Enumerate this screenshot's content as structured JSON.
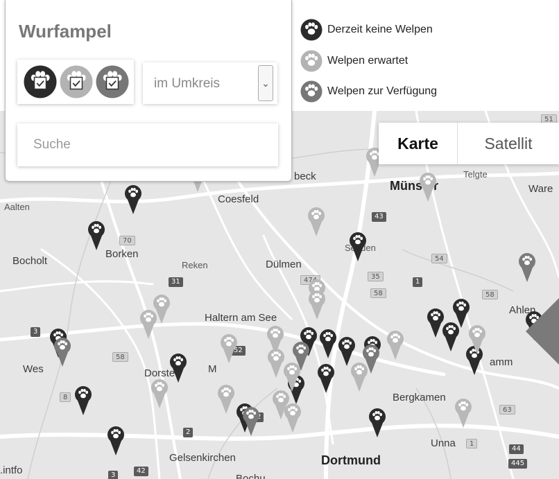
{
  "panel": {
    "title": "Wurfampel",
    "filters": [
      {
        "state": "Derzeit keine Welpen",
        "color": "#2b2b2b"
      },
      {
        "state": "Welpen erwartet",
        "color": "#b3b3b3"
      },
      {
        "state": "Welpen zur Verfügung",
        "color": "#777777"
      }
    ],
    "radius": {
      "value": "im Umkreis"
    },
    "search": {
      "placeholder": "Suche"
    }
  },
  "legend": [
    {
      "label": "Derzeit keine Welpen",
      "color": "#2b2b2b"
    },
    {
      "label": "Welpen erwartet",
      "color": "#b3b3b3"
    },
    {
      "label": "Welpen zur Verfügung",
      "color": "#777777"
    }
  ],
  "maptype": {
    "karte": "Karte",
    "satellit": "Satellit"
  },
  "places": [
    {
      "id": "muenster",
      "label": "Münster"
    },
    {
      "id": "telgte",
      "label": "Telgte"
    },
    {
      "id": "ware",
      "label": "Ware"
    },
    {
      "id": "beck",
      "label": "beck"
    },
    {
      "id": "aalten",
      "label": "Aalten"
    },
    {
      "id": "coesfeld",
      "label": "Coesfeld"
    },
    {
      "id": "senden",
      "label": "Senden"
    },
    {
      "id": "bocholt",
      "label": "Bocholt"
    },
    {
      "id": "borken",
      "label": "Borken"
    },
    {
      "id": "reken",
      "label": "Reken"
    },
    {
      "id": "duelmen",
      "label": "Dülmen"
    },
    {
      "id": "ahlen",
      "label": "Ahlen"
    },
    {
      "id": "haltern",
      "label": "Haltern am See"
    },
    {
      "id": "wes",
      "label": "Wes"
    },
    {
      "id": "dorste",
      "label": "Dorste"
    },
    {
      "id": "m",
      "label": "M"
    },
    {
      "id": "amm",
      "label": "amm"
    },
    {
      "id": "bergkamen",
      "label": "Bergkamen"
    },
    {
      "id": "unna",
      "label": "Unna"
    },
    {
      "id": "gelsenkirchen",
      "label": "Gelsenkirchen"
    },
    {
      "id": "dortmund",
      "label": "Dortmund"
    },
    {
      "id": "intfo",
      "label": ".intfo"
    },
    {
      "id": "bochu",
      "label": "Bochu"
    }
  ],
  "road_shields": [
    "51",
    "43",
    "70",
    "54",
    "474",
    "35",
    "58",
    "1",
    "58",
    "31",
    "3",
    "58",
    "52",
    "8",
    "2",
    "2",
    "63",
    "1",
    "44",
    "445",
    "42",
    "3"
  ],
  "markers": [
    {
      "status": "none"
    },
    {
      "status": "none"
    },
    {
      "status": "none"
    },
    {
      "status": "none"
    },
    {
      "status": "none"
    },
    {
      "status": "none"
    },
    {
      "status": "none"
    },
    {
      "status": "none"
    },
    {
      "status": "none"
    },
    {
      "status": "none"
    },
    {
      "status": "none"
    },
    {
      "status": "none"
    },
    {
      "status": "none"
    },
    {
      "status": "none"
    },
    {
      "status": "none"
    },
    {
      "status": "none"
    },
    {
      "status": "none"
    },
    {
      "status": "none"
    },
    {
      "status": "none"
    },
    {
      "status": "none"
    },
    {
      "status": "expected"
    },
    {
      "status": "expected"
    },
    {
      "status": "expected"
    },
    {
      "status": "expected"
    },
    {
      "status": "expected"
    },
    {
      "status": "expected"
    },
    {
      "status": "expected"
    },
    {
      "status": "expected"
    },
    {
      "status": "expected"
    },
    {
      "status": "expected"
    },
    {
      "status": "expected"
    },
    {
      "status": "expected"
    },
    {
      "status": "expected"
    },
    {
      "status": "expected"
    },
    {
      "status": "expected"
    },
    {
      "status": "expected"
    },
    {
      "status": "expected"
    },
    {
      "status": "expected"
    },
    {
      "status": "expected"
    },
    {
      "status": "expected"
    },
    {
      "status": "available"
    },
    {
      "status": "available"
    },
    {
      "status": "available"
    },
    {
      "status": "available"
    },
    {
      "status": "available"
    }
  ],
  "status_colors": {
    "none": "#2b2b2b",
    "expected": "#b8b8b8",
    "available": "#7a7a7a"
  }
}
